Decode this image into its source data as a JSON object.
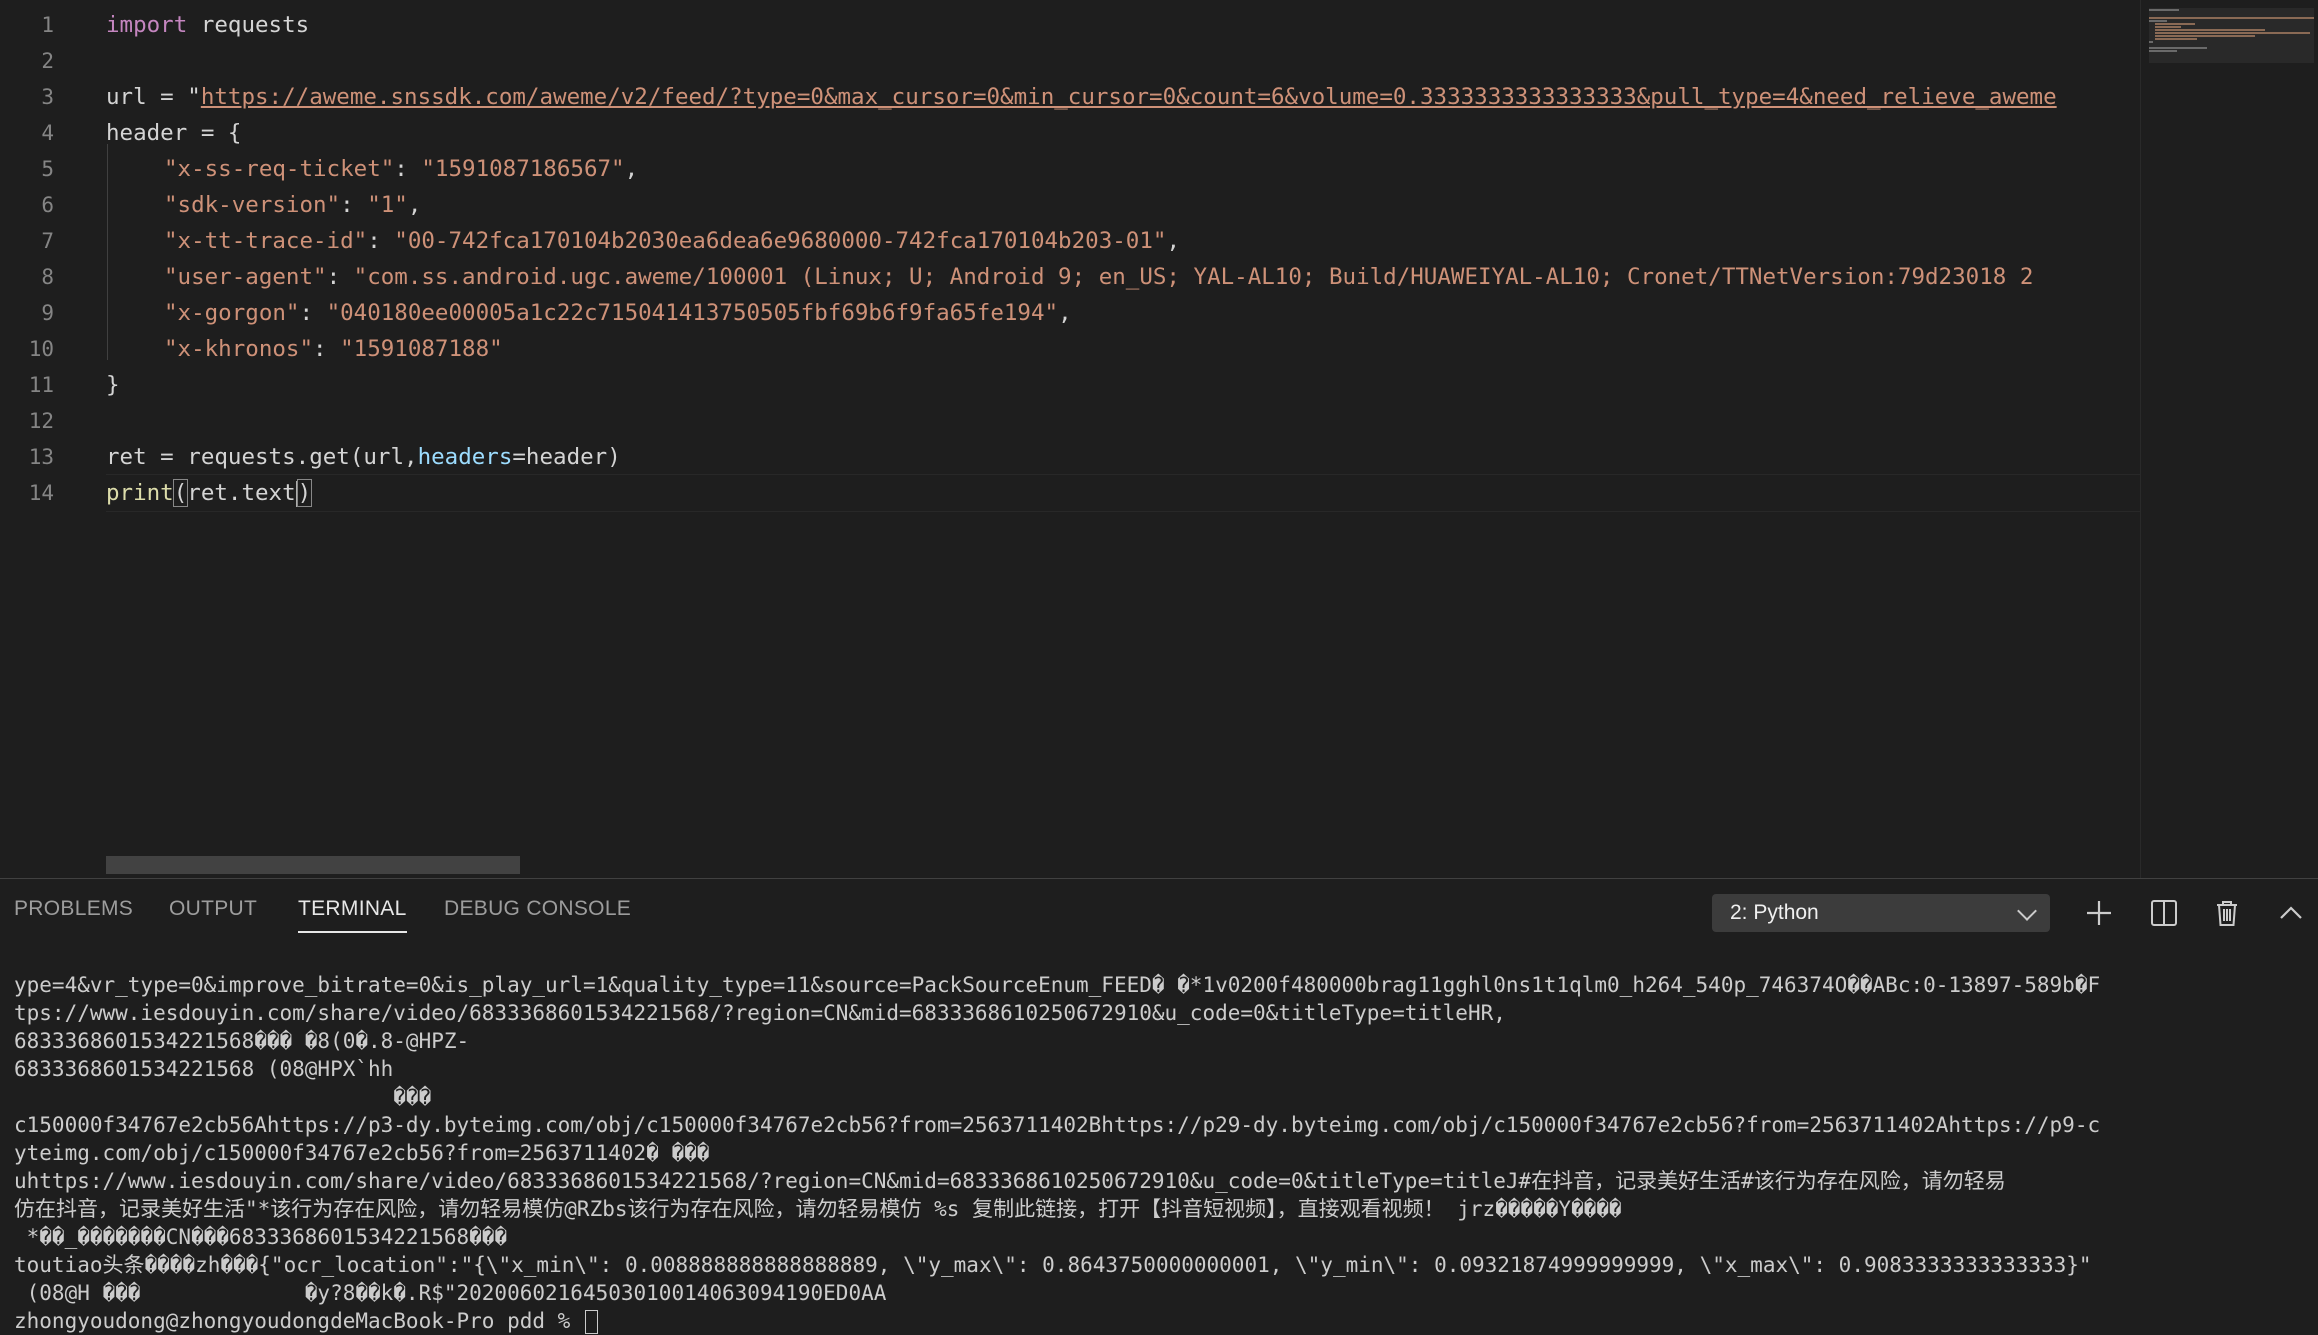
{
  "editor": {
    "line_numbers": [
      "1",
      "2",
      "3",
      "4",
      "5",
      "6",
      "7",
      "8",
      "9",
      "10",
      "11",
      "12",
      "13",
      "14"
    ],
    "code": {
      "l1_kw": "import",
      "l1_rest": " requests",
      "l3_pre": "url = \"",
      "l3_url": "https://aweme.snssdk.com/aweme/v2/feed/?type=0&max_cursor=0&min_cursor=0&count=6&volume=0.3333333333333333&pull_type=4&need_relieve_aweme",
      "l4": "header = {",
      "h1_key": "\"x-ss-req-ticket\"",
      "h1_val": "\"1591087186567\"",
      "h2_key": "\"sdk-version\"",
      "h2_val": "\"1\"",
      "h3_key": "\"x-tt-trace-id\"",
      "h3_val": "\"00-742fca170104b2030ea6dea6e9680000-742fca170104b203-01\"",
      "h4_key": "\"user-agent\"",
      "h4_val": "\"com.ss.android.ugc.aweme/100001 (Linux; U; Android 9; en_US; YAL-AL10; Build/HUAWEIYAL-AL10; Cronet/TTNetVersion:79d23018 2",
      "h5_key": "\"x-gorgon\"",
      "h5_val": "\"040180ee00005a1c22c715041413750505fbf69b6f9fa65fe194\"",
      "h6_key": "\"x-khronos\"",
      "h6_val": "\"1591087188\"",
      "sep": ": ",
      "comma": ",",
      "l11": "}",
      "l13_a": "ret = requests.get(url,",
      "l13_param": "headers",
      "l13_b": "=header)",
      "l14_fn": "print",
      "l14_open": "(",
      "l14_mid": "ret.text",
      "l14_close": ")"
    }
  },
  "panel": {
    "tabs": [
      "PROBLEMS",
      "OUTPUT",
      "TERMINAL",
      "DEBUG CONSOLE"
    ],
    "active_tab": "TERMINAL",
    "terminal_select": "2: Python",
    "icons": [
      "plus-icon",
      "split-icon",
      "trash-icon",
      "chevron-up-icon"
    ]
  },
  "terminal": {
    "lines": [
      "ype=4&vr_type=0&improve_bitrate=0&is_play_url=1&quality_type=11&source=PackSourceEnum_FEED� �*1v0200f480000brag11gghl0ns1t1qlm0_h264_540p_746374O��ABc:0-13897-589b�F",
      "tps://www.iesdouyin.com/share/video/6833368601534221568/?region=CN&mid=6833368610250672910&u_code=0&titleType=titleHR,",
      "6833368601534221568��� �8(0�.8-@HPZ-",
      "6833368601534221568 (08@HPX`hh",
      "                              ���",
      "c150000f34767e2cb56Ahttps://p3-dy.byteimg.com/obj/c150000f34767e2cb56?from=2563711402Bhttps://p29-dy.byteimg.com/obj/c150000f34767e2cb56?from=2563711402Ahttps://p9-c",
      "yteimg.com/obj/c150000f34767e2cb56?from=2563711402� ���",
      "uhttps://www.iesdouyin.com/share/video/6833368601534221568/?region=CN&mid=6833368610250672910&u_code=0&titleType=titleJ#在抖音，记录美好生活#该行为存在风险，请勿轻易",
      "仿在抖音，记录美好生活\"*该行为存在风险，请勿轻易模仿@RZbs该行为存在风险，请勿轻易模仿 %s 复制此链接，打开【抖音短视频】，直接观看视频！ jrz�����Y����",
      " *��_�������CN���6833368601534221568���",
      "toutiao头条����zh���{\"ocr_location\":\"{\\\"x_min\\\": 0.008888888888888889, \\\"y_max\\\": 0.8643750000000001, \\\"y_min\\\": 0.09321874999999999, \\\"x_max\\\": 0.9083333333333333}\"",
      " (08@H ���             �y?8��k�.R$\"20200602164503010014063094190ED0AA",
      "zhongyoudong@zhongyoudongdeMacBook-Pro pdd % "
    ]
  }
}
